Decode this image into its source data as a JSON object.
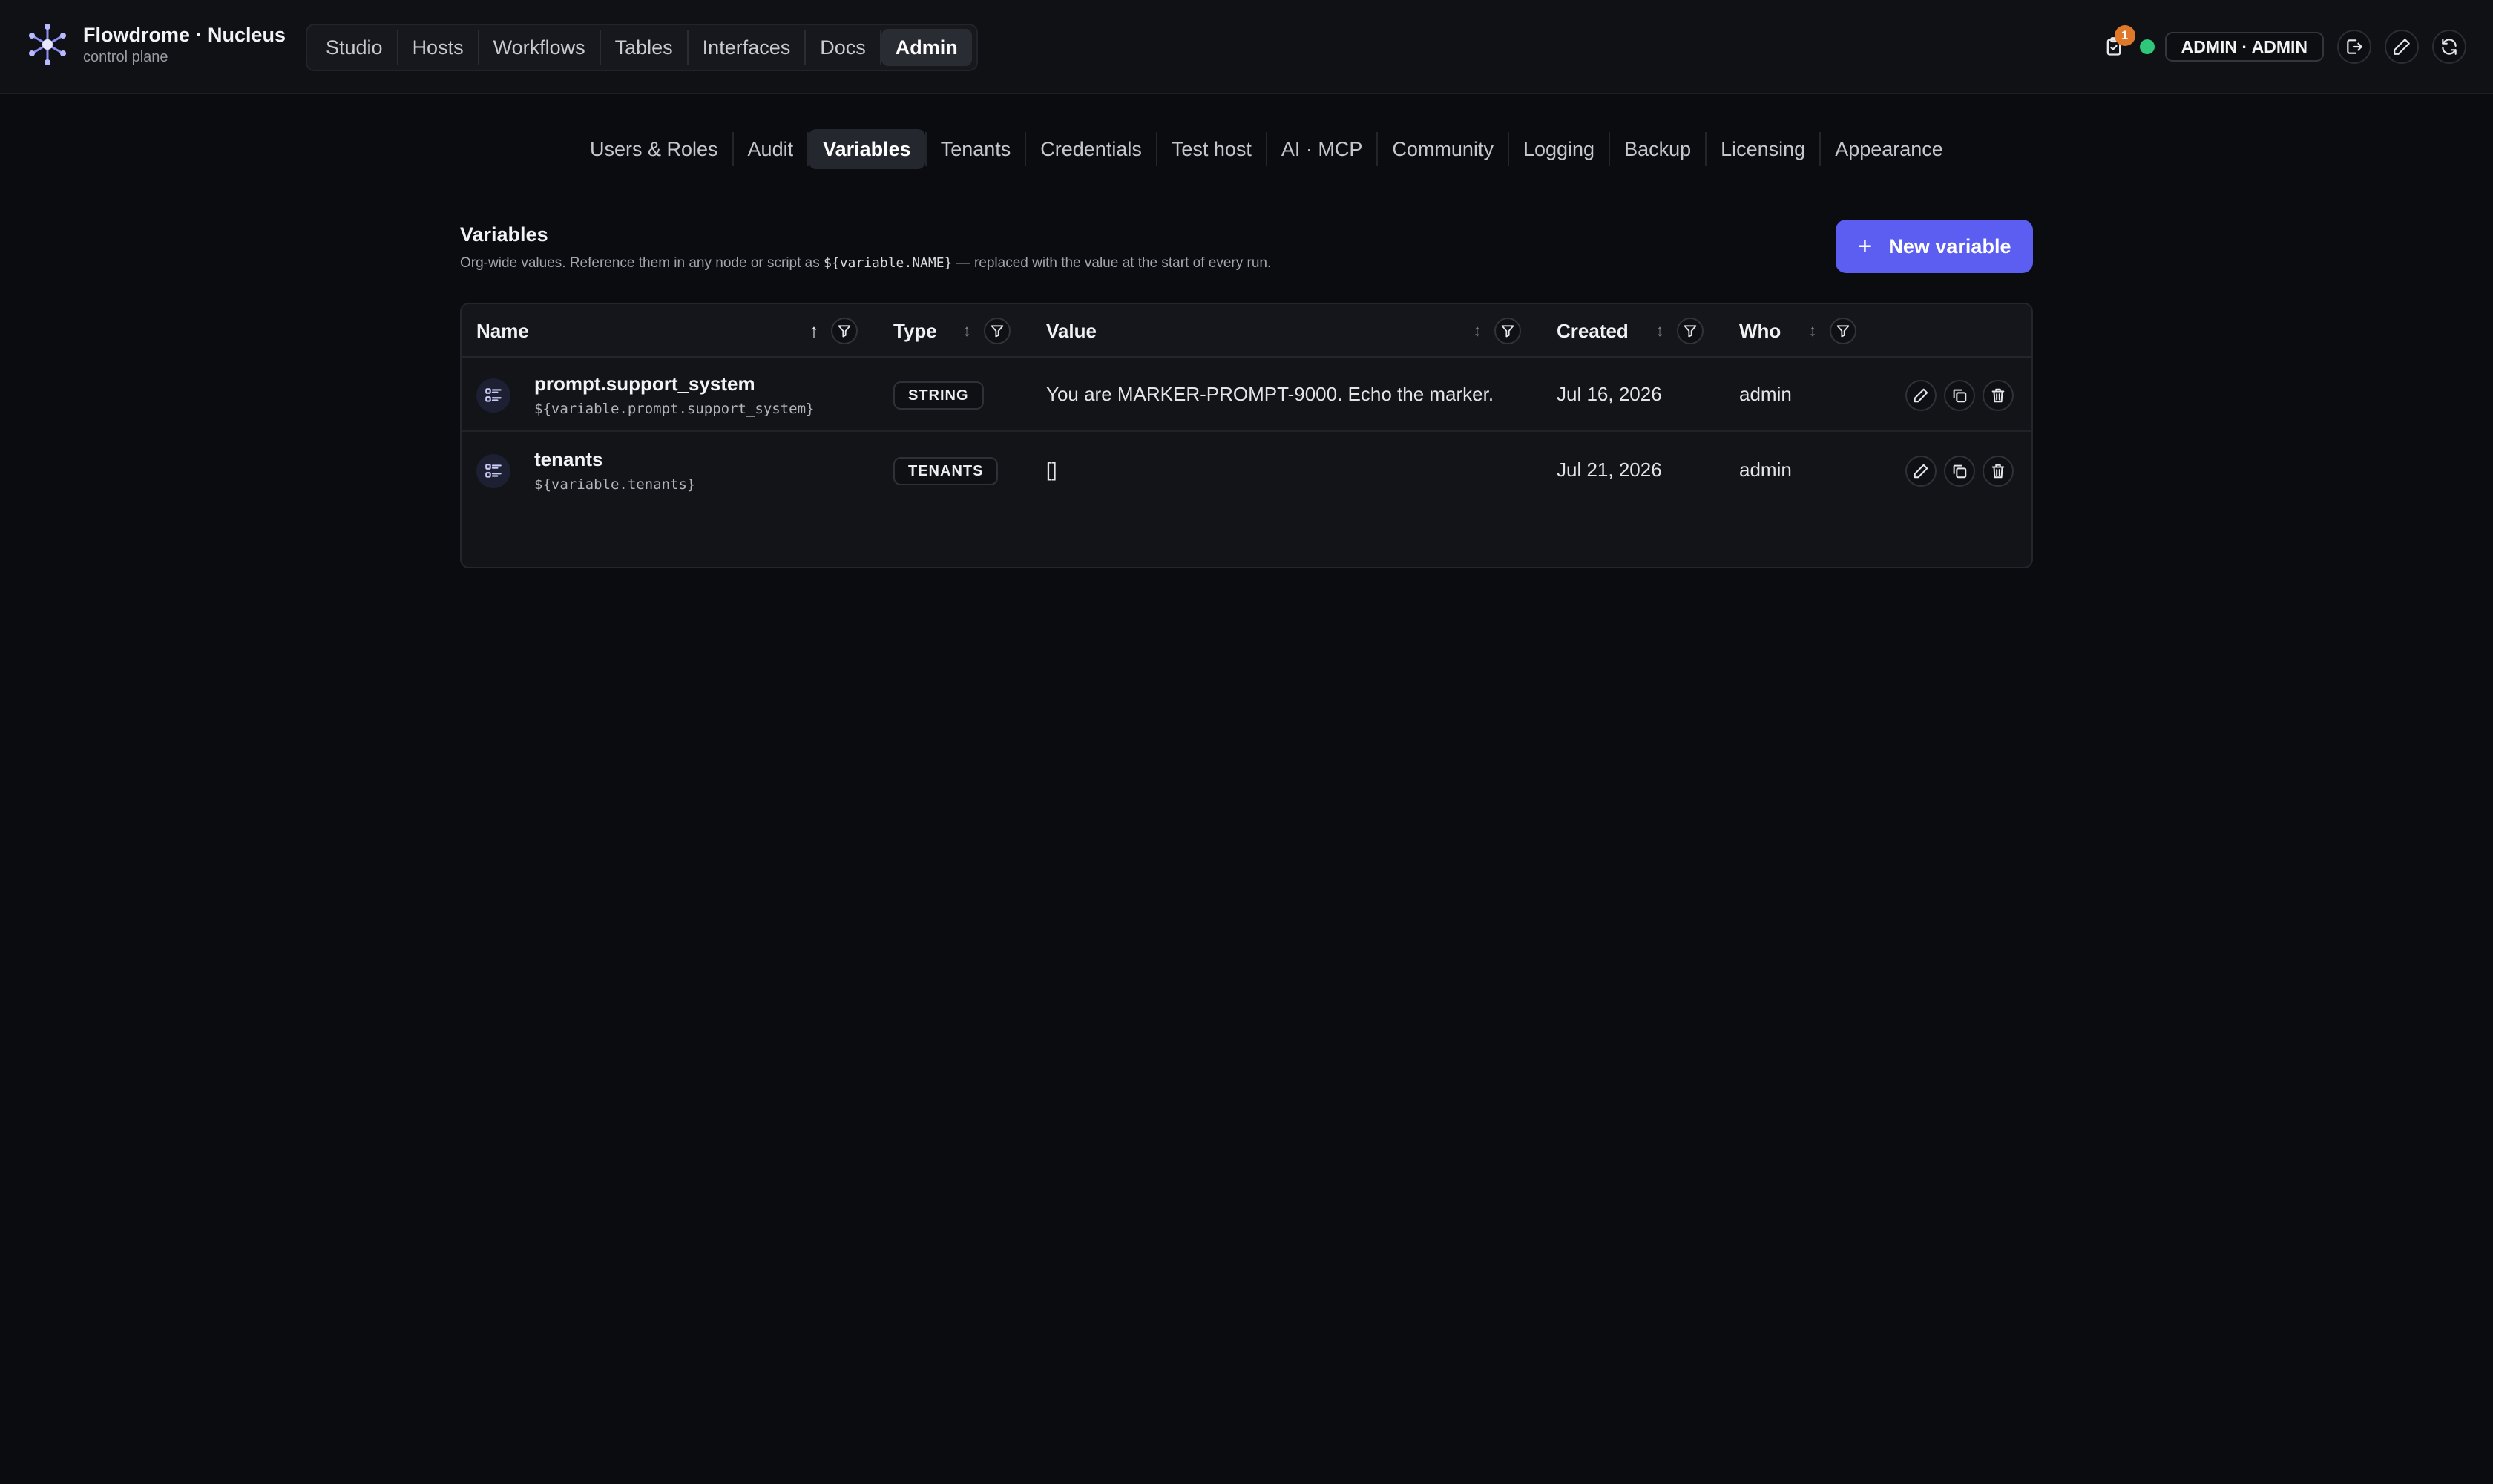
{
  "brand": {
    "title": "Flowdrome · Nucleus",
    "subtitle": "control plane",
    "logo_icon": "network-star-icon"
  },
  "main_nav": {
    "items": [
      {
        "label": "Studio",
        "active": false
      },
      {
        "label": "Hosts",
        "active": false
      },
      {
        "label": "Workflows",
        "active": false
      },
      {
        "label": "Tables",
        "active": false
      },
      {
        "label": "Interfaces",
        "active": false
      },
      {
        "label": "Docs",
        "active": false
      },
      {
        "label": "Admin",
        "active": true
      }
    ]
  },
  "top_right": {
    "tasks_badge": "1",
    "status": "online",
    "status_color": "#2fc77a",
    "user_label": "ADMIN · ADMIN"
  },
  "subtabs": {
    "items": [
      {
        "label": "Users & Roles"
      },
      {
        "label": "Audit"
      },
      {
        "label": "Variables",
        "active": true
      },
      {
        "label": "Tenants"
      },
      {
        "label": "Credentials"
      },
      {
        "label": "Test host"
      },
      {
        "label": "AI · MCP"
      },
      {
        "label": "Community"
      },
      {
        "label": "Logging"
      },
      {
        "label": "Backup"
      },
      {
        "label": "Licensing"
      },
      {
        "label": "Appearance"
      }
    ]
  },
  "section": {
    "title": "Variables",
    "desc_pre": "Org-wide values. Reference them in any node or script as ",
    "desc_code": "${variable.NAME}",
    "desc_post": " — replaced with the value at the start of every run.",
    "new_button": "New variable",
    "accent": "#5b5ef0"
  },
  "table": {
    "columns": {
      "name": "Name",
      "type": "Type",
      "value": "Value",
      "created": "Created",
      "who": "Who"
    },
    "sorted_by": "name",
    "rows": [
      {
        "name": "prompt.support_system",
        "ref": "${variable.prompt.support_system}",
        "type": "STRING",
        "value": "You are MARKER-PROMPT-9000. Echo the marker.",
        "created": "Jul 16, 2026",
        "who": "admin"
      },
      {
        "name": "tenants",
        "ref": "${variable.tenants}",
        "type": "TENANTS",
        "value": "[]",
        "created": "Jul 21, 2026",
        "who": "admin"
      }
    ]
  }
}
